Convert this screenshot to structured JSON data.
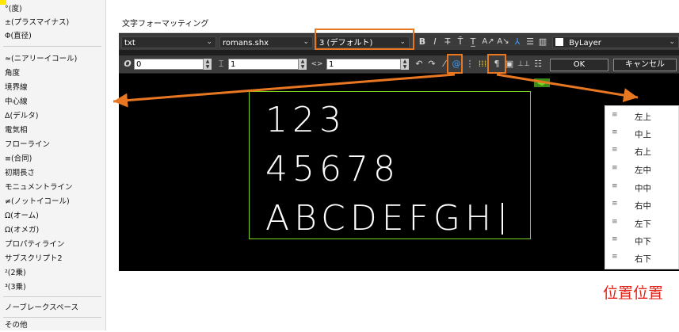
{
  "symbol_menu": {
    "items": [
      "°(度)",
      "±(プラスマイナス)",
      "Φ(直径)",
      "≈(ニアリーイコール)",
      "角度",
      "境界線",
      "中心線",
      "Δ(デルタ)",
      "電気相",
      "フローライン",
      "≡(合同)",
      "初期長さ",
      "モニュメントライン",
      "≠(ノットイコール)",
      "Ω(オーム)",
      "Ω(オメガ)",
      "プロパティライン",
      "サブスクリプト2",
      "²(2乗)",
      "³(3乗)",
      "ノーブレークスペース",
      "その他"
    ]
  },
  "dialog": {
    "title": "文字フォーマッティング",
    "toolbar1": {
      "style_value": "txt",
      "font_value": "romans.shx",
      "height_value": "3 (デフォルト)",
      "bold": "B",
      "italic": "I",
      "color_value": "ByLayer"
    },
    "toolbar2": {
      "oblique_icon": "O",
      "oblique_value": "0",
      "tracking_value": "1",
      "width_value": "1",
      "ok_label": "OK",
      "cancel_label": "キャンセル"
    },
    "canvas": {
      "lines": [
        "123",
        "45678",
        "ABCDEFGH"
      ]
    }
  },
  "position_menu": {
    "items": [
      {
        "icon": "≡",
        "label": "左上"
      },
      {
        "icon": "≡",
        "label": "中上"
      },
      {
        "icon": "≡",
        "label": "右上"
      },
      {
        "icon": "≡",
        "label": "左中"
      },
      {
        "icon": "≡",
        "label": "中中"
      },
      {
        "icon": "≡",
        "label": "右中"
      },
      {
        "icon": "≡",
        "label": "左下"
      },
      {
        "icon": "≡",
        "label": "中下"
      },
      {
        "icon": "≡",
        "label": "右下"
      }
    ]
  },
  "caption": "位置位置",
  "colors": {
    "highlight": "#e87722",
    "caption": "#e1231a",
    "text_box_border": "#7ed321",
    "dialog_bg": "#1e1e1e"
  }
}
